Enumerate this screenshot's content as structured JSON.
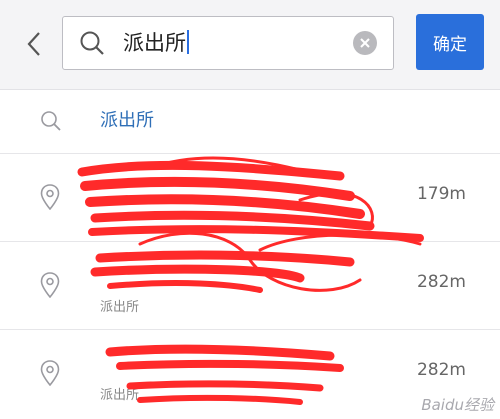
{
  "header": {
    "back_icon": "chevron-left-icon",
    "search": {
      "value": "派出所",
      "search_icon": "search-icon",
      "clear_icon": "clear-circle-icon"
    },
    "confirm_label": "确定",
    "accent": "#2a6fdb"
  },
  "suggestion": {
    "icon": "search-icon",
    "label": "派出所",
    "color": "#2f6fb7"
  },
  "results": [
    {
      "icon": "location-pin-icon",
      "subtitle": "",
      "distance": "179m"
    },
    {
      "icon": "location-pin-icon",
      "subtitle": "派出所",
      "distance": "282m"
    },
    {
      "icon": "location-pin-icon",
      "subtitle": "派出所",
      "distance": "282m"
    }
  ],
  "redaction_color": "#ff2a2a",
  "watermark": "Baidu经验"
}
